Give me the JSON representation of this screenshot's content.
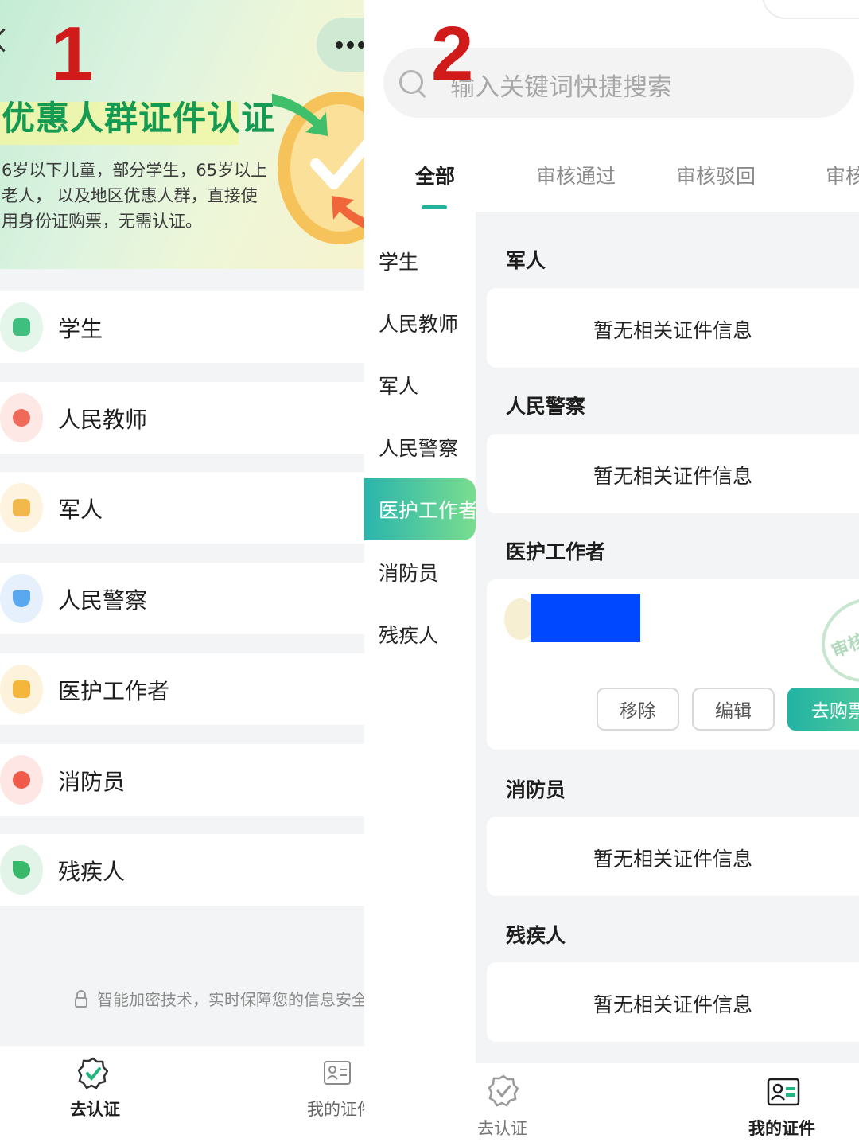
{
  "annotations": {
    "left_marker": "1",
    "right_marker": "2"
  },
  "left": {
    "banner": {
      "title": "优惠人群证件认证",
      "description": "6岁以下儿童，部分学生，65岁以上老人， 以及地区优惠人群，直接使用身份证购票，无需认证。",
      "more_icon": "ellipsis-icon",
      "back_icon": "chevron-left-icon"
    },
    "categories": [
      {
        "label": "学生",
        "icon": "student-icon",
        "color": "#3fbf7f"
      },
      {
        "label": "人民教师",
        "icon": "teacher-icon",
        "color": "#f06a5a"
      },
      {
        "label": "军人",
        "icon": "military-icon",
        "color": "#f2b84b"
      },
      {
        "label": "人民警察",
        "icon": "police-icon",
        "color": "#5aa8f0"
      },
      {
        "label": "医护工作者",
        "icon": "medical-icon",
        "color": "#f5b63c"
      },
      {
        "label": "消防员",
        "icon": "firefighter-icon",
        "color": "#ef5a4a"
      },
      {
        "label": "残疾人",
        "icon": "disabled-icon",
        "color": "#39b86a"
      }
    ],
    "security_note": "智能加密技术，实时保障您的信息安全",
    "tabbar": [
      {
        "label": "去认证",
        "icon": "certify-badge-icon",
        "active": true
      },
      {
        "label": "我的证件",
        "icon": "id-card-icon",
        "active": false
      }
    ]
  },
  "right": {
    "search": {
      "placeholder": "输入关键词快捷搜索",
      "icon": "search-icon"
    },
    "tabs": [
      "全部",
      "审核通过",
      "审核驳回",
      "审核"
    ],
    "active_tab": "全部",
    "sidebar": [
      "学生",
      "人民教师",
      "军人",
      "人民警察",
      "医护工作者",
      "消防员",
      "残疾人"
    ],
    "active_side": "医护工作者",
    "sections": [
      {
        "title": "军人",
        "empty_text": "暂无相关证件信息"
      },
      {
        "title": "人民警察",
        "empty_text": "暂无相关证件信息"
      },
      {
        "title": "医护工作者",
        "stamp_text": "审核通",
        "buttons": [
          "移除",
          "编辑",
          "去购票"
        ]
      },
      {
        "title": "消防员",
        "empty_text": "暂无相关证件信息"
      },
      {
        "title": "残疾人",
        "empty_text": "暂无相关证件信息"
      }
    ],
    "tabbar": [
      {
        "label": "去认证",
        "icon": "certify-badge-icon",
        "active": false
      },
      {
        "label": "我的证件",
        "icon": "id-card-icon",
        "active": true
      }
    ]
  }
}
